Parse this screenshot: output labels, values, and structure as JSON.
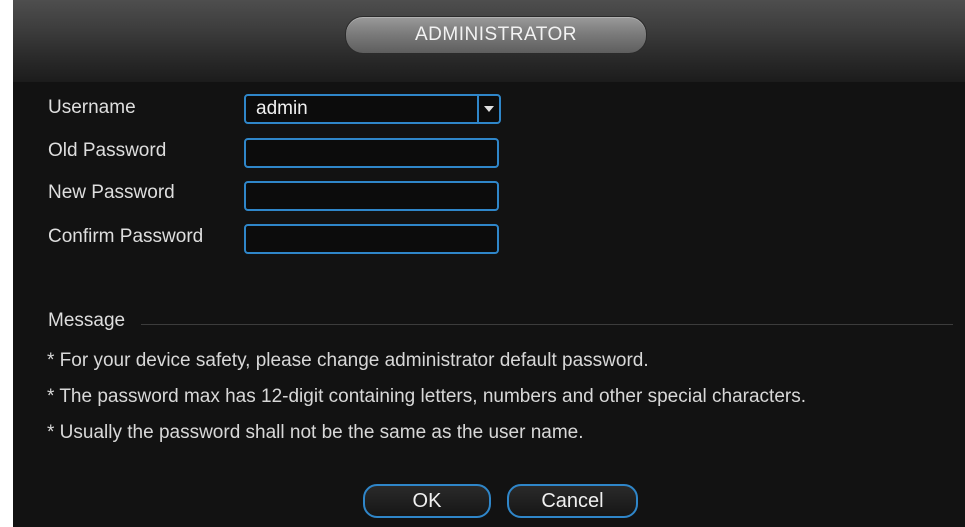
{
  "window": {
    "title": "ADMINISTRATOR"
  },
  "form": {
    "username_label": "Username",
    "username_value": "admin",
    "old_password_label": "Old Password",
    "old_password_value": "",
    "new_password_label": "New Password",
    "new_password_value": "",
    "confirm_password_label": "Confirm Password",
    "confirm_password_value": ""
  },
  "message": {
    "title": "Message",
    "lines": [
      "* For your device safety, please change administrator default password.",
      "* The password max has 12-digit containing letters, numbers and other special characters.",
      "* Usually the password shall not be the same as the user name."
    ]
  },
  "buttons": {
    "ok_label": "OK",
    "cancel_label": "Cancel"
  },
  "colors": {
    "background": "#121212",
    "accent_border": "#2f86c9",
    "title_pill": "#7c7c7c",
    "text": "#dedede"
  },
  "icons": {
    "dropdown": "chevron-down-icon"
  }
}
